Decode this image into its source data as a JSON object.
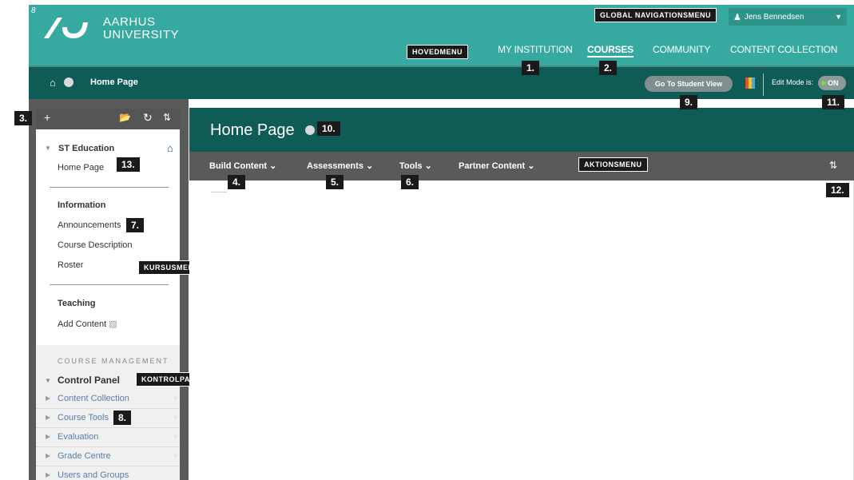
{
  "header": {
    "institution_line1": "AARHUS",
    "institution_line2": "UNIVERSITY",
    "pencil": "8",
    "global_nav_label": "GLOBAL NAVIGATIONSMENU",
    "user_name": "Jens Bennedsen",
    "main_menu_label": "HOVEDMENU",
    "nav": [
      "MY INSTITUTION",
      "COURSES",
      "COMMUNITY",
      "CONTENT COLLECTION"
    ]
  },
  "breadcrumb": {
    "page": "Home Page",
    "student_view": "Go To Student View",
    "edit_mode_label": "Edit Mode is:",
    "edit_mode_value": "ON"
  },
  "sidebar": {
    "course": "ST Education",
    "items_top": [
      "Home Page"
    ],
    "section_info": "Information",
    "items_info": [
      "Announcements",
      "Course Description",
      "Roster"
    ],
    "section_teaching": "Teaching",
    "items_teaching": [
      "Add Content"
    ],
    "course_menu_label": "KURSUSMENU",
    "course_management": "COURSE MANAGEMENT",
    "control_panel": "Control Panel",
    "control_panel_label": "KONTROLPANEL",
    "control_items": [
      "Content Collection",
      "Course Tools",
      "Evaluation",
      "Grade Centre",
      "Users and Groups"
    ]
  },
  "main": {
    "title": "Home Page",
    "actions": [
      "Build Content",
      "Assessments",
      "Tools",
      "Partner Content"
    ],
    "action_menu_label": "AKTIONSMENU"
  },
  "callouts": [
    "1.",
    "2.",
    "3.",
    "4.",
    "5.",
    "6.",
    "7.",
    "8.",
    "9.",
    "10.",
    "11.",
    "12.",
    "13."
  ],
  "colors": {
    "header": "#36aaa0",
    "dark_teal": "#0f5b56",
    "action_bar": "#5a5a5a"
  }
}
